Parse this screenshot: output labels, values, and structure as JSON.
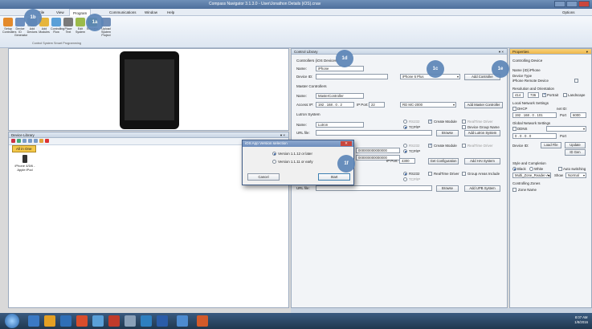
{
  "window": {
    "title": "Compass Navigator 3.1.3.0 - User\\Jonathon Details (iOS).cnav",
    "options_label": "Options"
  },
  "menu": [
    "File",
    "View",
    "Program",
    "Communications",
    "Window",
    "Help"
  ],
  "ribbon": {
    "buttons": [
      "Setup Controllers",
      "Device ID Generator",
      "Add Devices",
      "Add Modules",
      "Controlling Flow",
      "Place Text",
      "Edit System",
      "Emulator",
      "Upload System Project"
    ],
    "group_caption": "Control System Smart Programming"
  },
  "callouts": [
    "1b",
    "1a",
    "1d",
    "1c",
    "1e",
    "1f"
  ],
  "device_library": {
    "title": "Device Library",
    "tab": "All in One",
    "item": "iPhone 4/5/6 - Apple iPod"
  },
  "control_library": {
    "title": "Control Library",
    "controllers_section": "Controllers (iOS Devices)",
    "name_label": "Name:",
    "name_value": "iPhone",
    "device_id_label": "Device ID:",
    "device_model": "iPhone 6 Plus",
    "add_controller": "Add Controller",
    "master_section": "Master Controllers",
    "master_name_label": "Name:",
    "master_name_value": "MasterController",
    "access_label": "Access:",
    "ip_label": "IP:",
    "ip_value": "192 . 168 . 0 . 2",
    "ip_port_label": "IP Port:",
    "ip_port_value": "22",
    "master_model": "RD MC-2000",
    "add_master": "Add Master Controller",
    "lutron_section": "Lutron System",
    "lutron_name_label": "Name:",
    "lutron_name_value": "Lutron",
    "url_label": "URL file:",
    "rs232": "RS232",
    "tcpip": "TCP/IP",
    "create_module": "Create Module",
    "realtime_driver": "RealTime Driver",
    "device_group_name": "Device Group Name",
    "browse": "Browse",
    "add_lutron": "Add Lutron System",
    "hex_value": "000000000000000",
    "port_label": "IP Port:",
    "port_value": "4300",
    "get_config": "Get Configuration",
    "add_hai": "Add HAI System",
    "group_areas": "Group Areas Include",
    "add_upb": "Add UPB System"
  },
  "dialog": {
    "title": "iOS App Version selection",
    "option1": "Version 1.1.12 or later",
    "option2": "Version 1.1.11 or early",
    "cancel": "Cancel",
    "start": "Start"
  },
  "properties": {
    "title": "Properties",
    "controlling_device": "Controlling Device",
    "name_label": "Name (ID)",
    "name_value": "iPhone",
    "device_type": "Device Type",
    "device_type_value": "iPhone Remote Device",
    "resolution": "Resolution and Orientation",
    "res_w": "414",
    "res_h": "736",
    "portrait": "Portrait",
    "landscape": "Landscape",
    "local_net": "Local Network Settings",
    "dhcp": "DHCP",
    "net_id": "net ID:",
    "local_ip": "192 . 168 . 0 . 101",
    "port_label": "Port",
    "port_value": "6000",
    "global_net": "Global Network Settings",
    "ddns": "DDNS",
    "ext_ip": "0 . 0 . 0 . 0",
    "device_id": "Device ID:",
    "load_file": "Load File",
    "update": "Update",
    "id_gen": "ID Gen",
    "style": "Style and Completion",
    "black": "Black",
    "white": "White",
    "auto_switching": "Auto switching",
    "style_value": "Multi_Zone_Reader-Au",
    "show": "Show",
    "normal": "Normal",
    "controlling_zones": "Controlling Zones",
    "zone_name": "Zone Name"
  },
  "taskbar": {
    "time": "8:07 AM",
    "date": "1/8/2016"
  }
}
